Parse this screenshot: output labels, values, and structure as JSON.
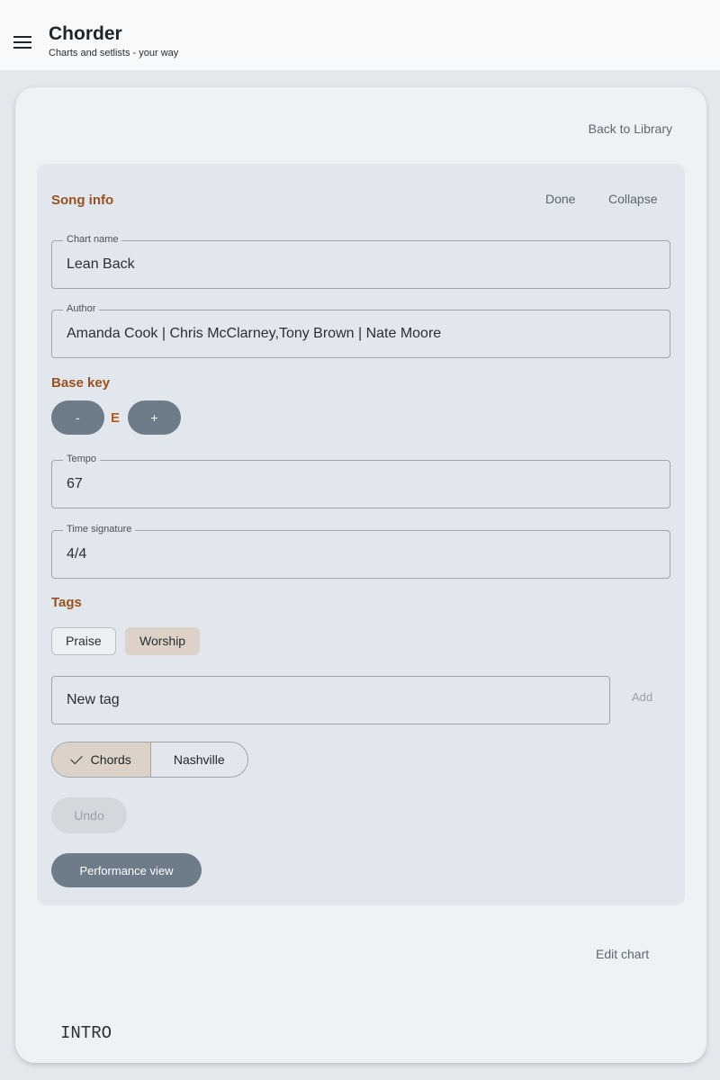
{
  "app_bar": {
    "title": "Chorder",
    "subtitle": "Charts and setlists - your way",
    "menu_icon": "menu-icon"
  },
  "card": {
    "back_label": "Back to Library",
    "edit_chart_label": "Edit chart",
    "intro_text": "INTRO"
  },
  "song_info": {
    "title": "Song info",
    "done_label": "Done",
    "collapse_label": "Collapse",
    "chart_name": {
      "label": "Chart name",
      "value": "Lean Back"
    },
    "author": {
      "label": "Author",
      "value": "Amanda Cook | Chris McClarney,Tony Brown | Nate Moore"
    },
    "base_key": {
      "title": "Base key",
      "minus_label": "-",
      "plus_label": "+",
      "value": "E"
    },
    "tempo": {
      "label": "Tempo",
      "value": "67"
    },
    "time_signature": {
      "label": "Time signature",
      "value": "4/4"
    },
    "tags": {
      "title": "Tags",
      "items": [
        {
          "label": "Praise",
          "selected": false
        },
        {
          "label": "Worship",
          "selected": true
        }
      ],
      "new_tag_placeholder": "New tag",
      "add_label": "Add"
    },
    "notation": {
      "options": [
        "Chords",
        "Nashville"
      ],
      "selected": "Chords"
    },
    "undo_label": "Undo",
    "performance_label": "Performance view"
  },
  "colors": {
    "accent": "#99521f",
    "button": "#6e7b89",
    "selected_chip": "#ddd2c7"
  }
}
